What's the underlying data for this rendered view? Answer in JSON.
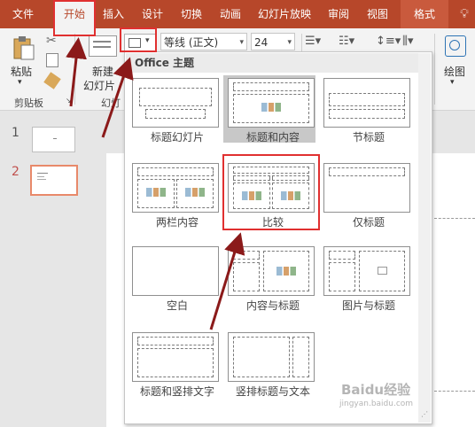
{
  "ribbon": {
    "tabs": [
      {
        "label": "文件"
      },
      {
        "label": "开始"
      },
      {
        "label": "插入"
      },
      {
        "label": "设计"
      },
      {
        "label": "切换"
      },
      {
        "label": "动画"
      },
      {
        "label": "幻灯片放映"
      },
      {
        "label": "审阅"
      },
      {
        "label": "视图"
      },
      {
        "label": "格式"
      }
    ],
    "paste_label": "粘贴",
    "new_slide_label_1": "新建",
    "new_slide_label_2": "幻灯片",
    "clipboard_group": "剪贴板",
    "slides_group": "幻灯",
    "font_name": "等线 (正文)",
    "font_size": "24",
    "draw_label": "绘图"
  },
  "slide_panel": {
    "slides": [
      {
        "number": "1"
      },
      {
        "number": "2"
      }
    ]
  },
  "layout_dropdown": {
    "header": "Office 主题",
    "layouts": [
      {
        "name": "标题幻灯片"
      },
      {
        "name": "标题和内容"
      },
      {
        "name": "节标题"
      },
      {
        "name": "两栏内容"
      },
      {
        "name": "比较"
      },
      {
        "name": "仅标题"
      },
      {
        "name": "空白"
      },
      {
        "name": "内容与标题"
      },
      {
        "name": "图片与标题"
      },
      {
        "name": "标题和竖排文字"
      },
      {
        "name": "竖排标题与文本"
      }
    ]
  },
  "watermark": {
    "line1": "Baidu经验",
    "line2": "jingyan.baidu.com"
  },
  "colors": {
    "ribbon_accent": "#b7472a",
    "annotation_red": "#e03030",
    "arrow_dark_red": "#8b1a1a"
  }
}
